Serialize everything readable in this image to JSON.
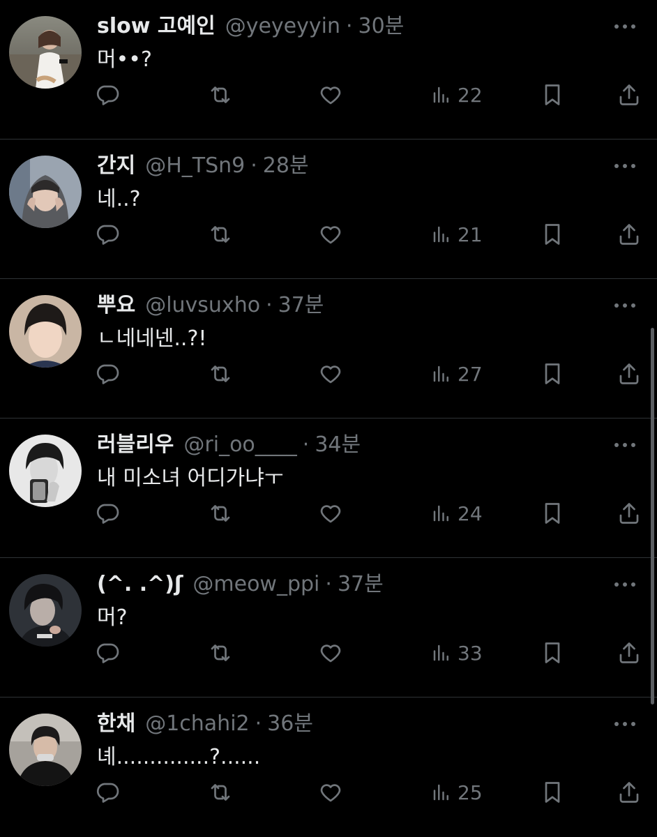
{
  "colors": {
    "background": "#000000",
    "text": "#e7e9ea",
    "muted": "#71767b",
    "divider": "#2f3336"
  },
  "tweets": [
    {
      "name": "slow 고예인",
      "handle": "@yeyeyyin",
      "time": "30분",
      "text": "머••?",
      "views": "22",
      "avatar": "avatar-photo"
    },
    {
      "name": "간지",
      "handle": "@H_TSn9",
      "time": "28분",
      "text": "네..?",
      "views": "21",
      "avatar": "avatar-photo"
    },
    {
      "name": "뿌요",
      "handle": "@luvsuxho",
      "time": "37분",
      "text": "ㄴ네네넨..?!",
      "views": "27",
      "avatar": "avatar-photo"
    },
    {
      "name": "러블리우",
      "handle": "@ri_oo____",
      "time": "34분",
      "text": "내 미소녀 어디가냐ㅜ",
      "views": "24",
      "avatar": "avatar-photo"
    },
    {
      "name": "(^. .^)ʃ",
      "handle": "@meow_ppi",
      "time": "37분",
      "text": "머?",
      "views": "33",
      "avatar": "avatar-photo"
    },
    {
      "name": "한채",
      "handle": "@1chahi2",
      "time": "36분",
      "text": "녜..............?......",
      "views": "25",
      "avatar": "avatar-photo"
    }
  ],
  "icons": {
    "reply": "reply-icon",
    "retweet": "retweet-icon",
    "like": "heart-icon",
    "views": "views-icon",
    "bookmark": "bookmark-icon",
    "share": "share-icon",
    "more": "more-icon"
  }
}
